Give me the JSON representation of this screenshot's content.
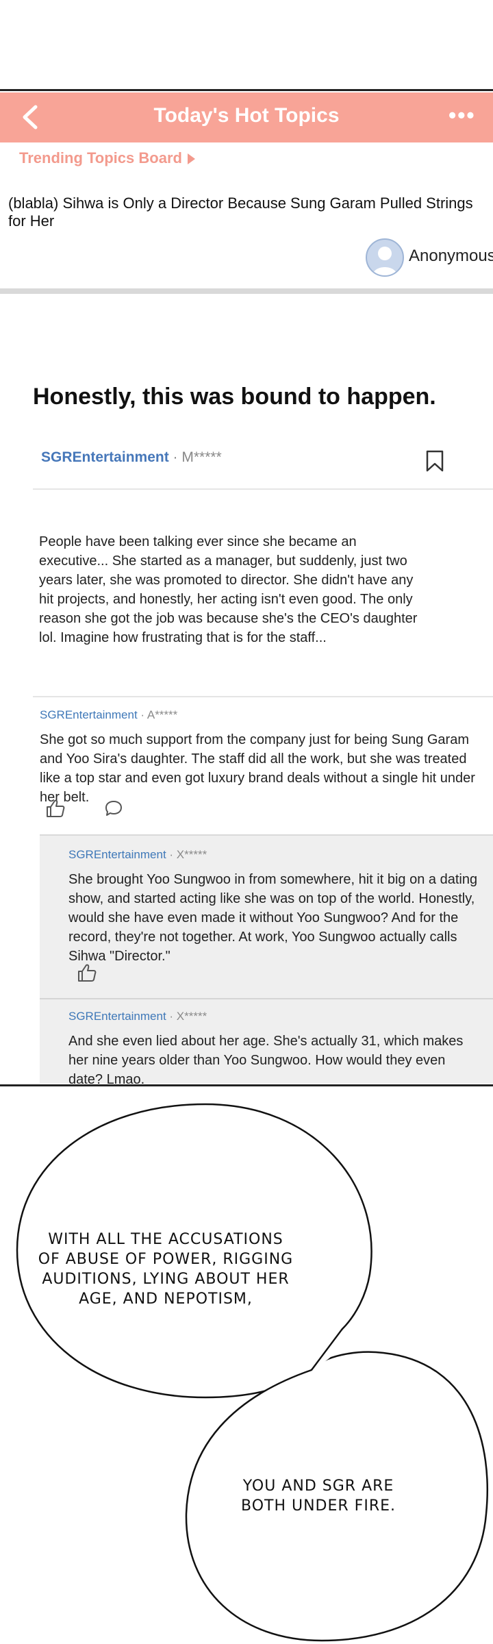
{
  "header": {
    "title": "Today's Hot Topics",
    "back_icon": "chevron-left-icon",
    "more_label": "•••",
    "color": "#f8a497"
  },
  "board_link": "Trending Topics Board",
  "post": {
    "title": "(blabla) Sihwa is Only a Director Because Sung Garam Pulled Strings for Her",
    "author": "Anonymous"
  },
  "article": {
    "headline": "Honestly, this was bound to happen.",
    "org": "SGREntertainment",
    "user": " · M*****",
    "body": "People have been talking ever since she became an executive... She started as a manager, but suddenly, just two years later, she was promoted to director. She didn't have any hit projects, and honestly, her acting isn't even good. The only reason she got the job was because she's the CEO's daughter lol. Imagine how frustrating that is for the staff..."
  },
  "comments": [
    {
      "org": "SGREntertainment",
      "user": " · A*****",
      "text": "She got so much support from the company just for being Sung Garam and Yoo Sira's daughter. The staff did all the work, but she was treated like a top star and even got luxury brand deals without a single hit under her belt."
    },
    {
      "org": "SGREntertainment",
      "user": " · X*****",
      "text": "She brought Yoo Sungwoo in from somewhere, hit it big on a dating show, and started acting like she was on top of the world. Honestly, would she have even made it without Yoo Sungwoo? And for the record, they're not together. At work, Yoo Sungwoo actually calls Sihwa \"Director.\""
    },
    {
      "org": "SGREntertainment",
      "user": " · X*****",
      "text": "And she even lied about her age. She's actually 31, which makes her nine years older than Yoo Sungwoo. How would they even date? Lmao."
    }
  ],
  "bubbles": {
    "first": "WITH ALL THE ACCUSATIONS OF ABUSE OF POWER, RIGGING AUDITIONS, LYING ABOUT HER AGE, AND NEPOTISM,",
    "second": "YOU AND SGR ARE BOTH UNDER FIRE."
  }
}
